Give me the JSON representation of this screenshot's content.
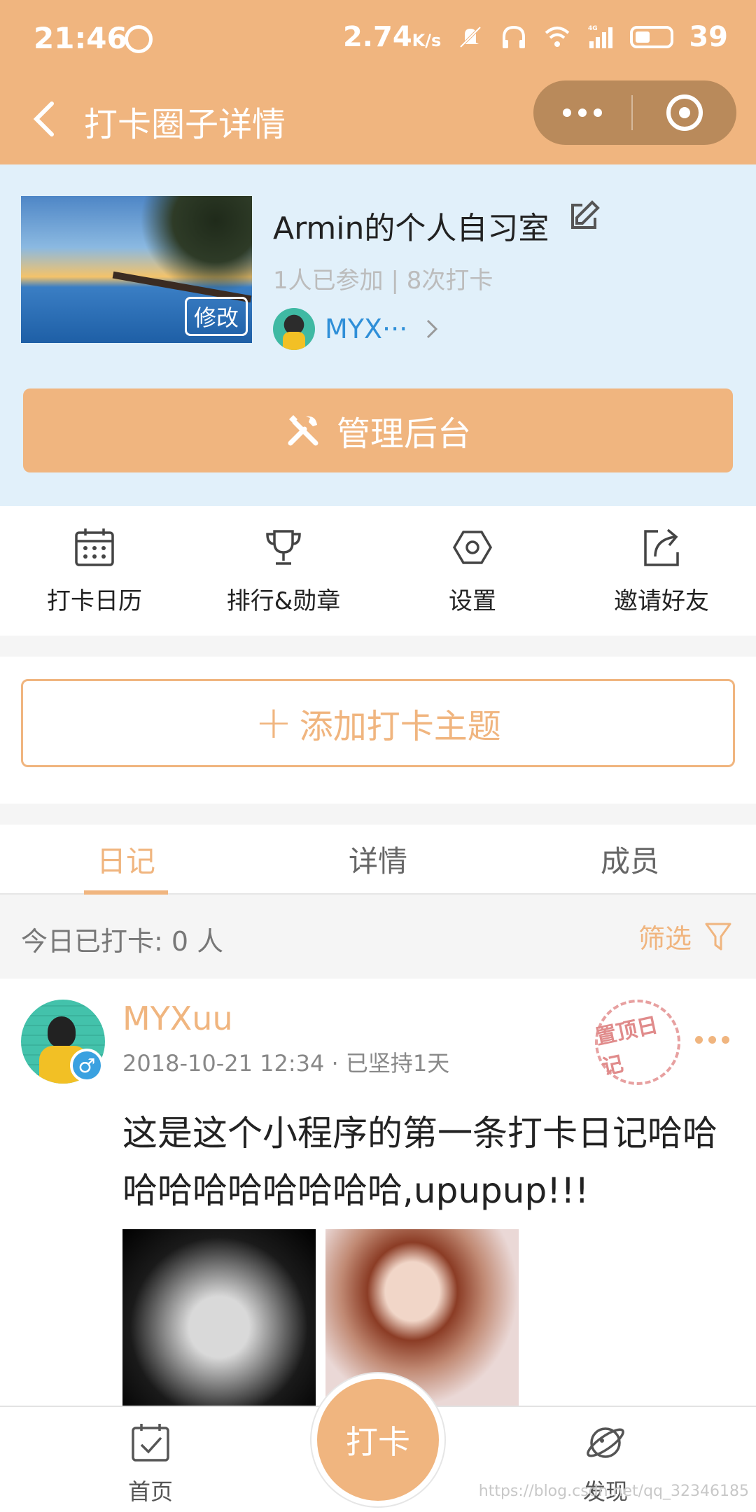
{
  "status_bar": {
    "time": "21:46",
    "speed": "2.74",
    "speed_unit": "K/s",
    "network": "4G",
    "battery": "39"
  },
  "nav": {
    "title": "打卡圈子详情"
  },
  "circle": {
    "cover_edit_label": "修改",
    "name": "Armin的个人自习室",
    "stats": "1人已参加 | 8次打卡",
    "owner_name": "MYX···",
    "manage_label": "管理后台"
  },
  "actions": [
    {
      "label": "打卡日历",
      "icon": "calendar-icon"
    },
    {
      "label": "排行&勋章",
      "icon": "trophy-icon"
    },
    {
      "label": "设置",
      "icon": "settings-icon"
    },
    {
      "label": "邀请好友",
      "icon": "share-icon"
    }
  ],
  "add_topic_label": "添加打卡主题",
  "tabs": [
    {
      "label": "日记",
      "active": true
    },
    {
      "label": "详情",
      "active": false
    },
    {
      "label": "成员",
      "active": false
    }
  ],
  "today": {
    "count_text": "今日已打卡: 0 人",
    "filter_label": "筛选"
  },
  "post": {
    "user": "MYXuu",
    "meta": "2018-10-21 12:34 · 已坚持1天",
    "stamp": "置顶日记",
    "text": "这是这个小程序的第一条打卡日记哈哈哈哈哈哈哈哈哈哈,upupup!!!",
    "gender": "♂"
  },
  "tabbar": {
    "home_label": "首页",
    "checkin_label": "打卡",
    "discover_label": "发现"
  },
  "watermark": "https://blog.csdn.net/qq_32346185",
  "colors": {
    "accent": "#f0b57f",
    "header_bg": "#e1f0fa",
    "link": "#2f8fd8"
  }
}
